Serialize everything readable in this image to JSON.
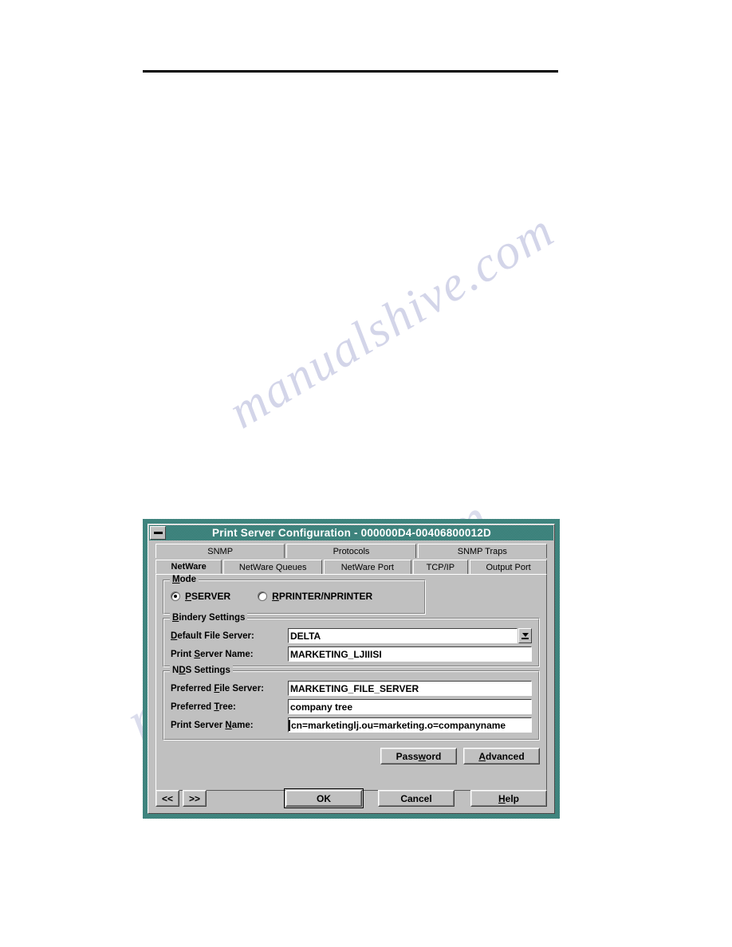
{
  "page": {
    "rule": "horizontal-rule",
    "watermark_text": "manualshive.com"
  },
  "window": {
    "title": "Print Server Configuration - 000000D4-00406800012D",
    "sysmenu_icon": "minimize-bar-icon"
  },
  "tabs": {
    "top_row": [
      {
        "label": "SNMP",
        "active": false
      },
      {
        "label": "Protocols",
        "active": false
      },
      {
        "label": "SNMP Traps",
        "active": false
      }
    ],
    "bottom_row": [
      {
        "label": "NetWare",
        "active": true
      },
      {
        "label": "NetWare Queues",
        "active": false
      },
      {
        "label": "NetWare Port",
        "active": false
      },
      {
        "label": "TCP/IP",
        "active": false
      },
      {
        "label": "Output Port",
        "active": false
      }
    ]
  },
  "mode": {
    "group_title": "Mode",
    "options": [
      {
        "label": "PSERVER",
        "selected": true
      },
      {
        "label": "RPRINTER/NPRINTER",
        "selected": false
      }
    ]
  },
  "bindery": {
    "group_title": "Bindery Settings",
    "fields": [
      {
        "label": "Default File Server:",
        "value": "DELTA",
        "control": "combobox"
      },
      {
        "label": "Print Server Name:",
        "value": "MARKETING_LJIIISI",
        "control": "textbox"
      }
    ]
  },
  "nds": {
    "group_title": "NDS Settings",
    "fields": [
      {
        "label": "Preferred File Server:",
        "value": "MARKETING_FILE_SERVER",
        "control": "textbox"
      },
      {
        "label": "Preferred Tree:",
        "value": "company tree",
        "control": "textbox"
      },
      {
        "label": "Print Server Name:",
        "value": "cn=marketinglj.ou=marketing.o=companyname",
        "control": "textbox",
        "focused": true
      }
    ]
  },
  "aux_buttons": {
    "password": "Password",
    "advanced": "Advanced"
  },
  "bottom_buttons": {
    "prev": "<<",
    "next": ">>",
    "ok": "OK",
    "cancel": "Cancel",
    "help": "Help"
  },
  "colors": {
    "titlebar_teal": "#4f9b94",
    "titlebar_teal_dark": "#2c6a65",
    "dialog_face": "#c0c0c0",
    "field_bg": "#ffffff",
    "text": "#000000",
    "watermark": "#b9bcdc"
  }
}
